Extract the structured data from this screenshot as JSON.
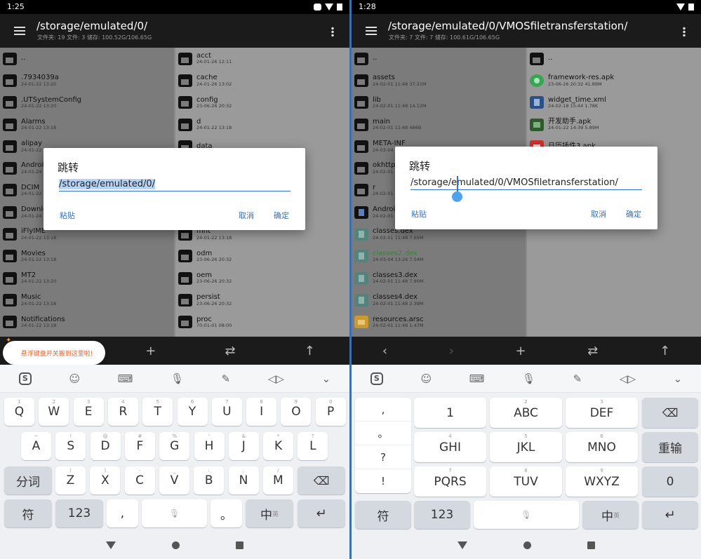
{
  "left": {
    "status": {
      "time": "1:25"
    },
    "appbar": {
      "title": "/storage/emulated/0/",
      "subtitle": "文件夹: 19  文件: 3  储存: 100.52G/106.65G"
    },
    "col1": [
      {
        "name": "..",
        "meta": ""
      },
      {
        "name": ".7934039a",
        "meta": "24-01-22 13:20"
      },
      {
        "name": ".UTSystemConfig",
        "meta": "24-01-22 13:20"
      },
      {
        "name": "Alarms",
        "meta": "24-01-22 13:18"
      },
      {
        "name": "alipay",
        "meta": "24-01-22"
      },
      {
        "name": "Android",
        "meta": "24-01-24"
      },
      {
        "name": "DCIM",
        "meta": "24-01-22"
      },
      {
        "name": "Download",
        "meta": "24-01-24"
      },
      {
        "name": "iFlyIME",
        "meta": "24-01-22 13:18"
      },
      {
        "name": "Movies",
        "meta": "24-01-22 13:18"
      },
      {
        "name": "MT2",
        "meta": "24-01-22 13:20"
      },
      {
        "name": "Music",
        "meta": "24-01-22 13:18"
      },
      {
        "name": "Notifications",
        "meta": "24-01-22 13:18"
      }
    ],
    "col2": [
      {
        "name": "acct",
        "meta": "24-01-26 12:11"
      },
      {
        "name": "cache",
        "meta": "24-01-26 13:02"
      },
      {
        "name": "config",
        "meta": "23-06-26 20:32"
      },
      {
        "name": "d",
        "meta": "24-01-22 13:18"
      },
      {
        "name": "data",
        "meta": ""
      },
      {
        "name": "",
        "meta": ""
      },
      {
        "name": "",
        "meta": ""
      },
      {
        "name": "",
        "meta": ""
      },
      {
        "name": "mnt",
        "meta": "24-01-22 13:18"
      },
      {
        "name": "odm",
        "meta": "23-06-26 20:32"
      },
      {
        "name": "oem",
        "meta": "23-06-26 20:32"
      },
      {
        "name": "persist",
        "meta": "23-06-26 20:32"
      },
      {
        "name": "proc",
        "meta": "70-01-01 08:00"
      }
    ],
    "dialog": {
      "title": "跳转",
      "value": "/storage/emulated/0/",
      "paste": "粘贴",
      "cancel": "取消",
      "ok": "确定"
    },
    "toast": "悬浮键盘开关搬到这里啦!",
    "toolbar": [
      "+",
      "⇄",
      "↑"
    ]
  },
  "right": {
    "status": {
      "time": "1:28"
    },
    "appbar": {
      "title": "/storage/emulated/0/VMOSfiletransferstation/",
      "subtitle": "文件夹: 7  文件: 7  储存: 100.61G/106.65G"
    },
    "col1": [
      {
        "name": "..",
        "meta": "",
        "icon": "folder"
      },
      {
        "name": "assets",
        "meta": "24-02-01 11:48  37.21M",
        "icon": "folder"
      },
      {
        "name": "lib",
        "meta": "24-02-01 11:48  14.12M",
        "icon": "folder"
      },
      {
        "name": "main",
        "meta": "24-02-01 11:48  486B",
        "icon": "folder"
      },
      {
        "name": "META-INF",
        "meta": "24-03-04",
        "icon": "folder"
      },
      {
        "name": "okhttp3",
        "meta": "24-02-01",
        "icon": "folder"
      },
      {
        "name": "r",
        "meta": "24-02-01",
        "icon": "folder"
      },
      {
        "name": "Android",
        "meta": "24-02-01",
        "icon": "doc"
      },
      {
        "name": "classes.dex",
        "meta": "24-02-01 11:48  7.65M",
        "icon": "dex"
      },
      {
        "name": "classes2.dex",
        "meta": "24-03-04 13:26  7.54M",
        "icon": "dex",
        "green": true
      },
      {
        "name": "classes3.dex",
        "meta": "24-02-01 11:48  7.90M",
        "icon": "dex"
      },
      {
        "name": "classes4.dex",
        "meta": "24-02-01 11:48  2.39M",
        "icon": "dex"
      },
      {
        "name": "resources.arsc",
        "meta": "24-02-01 11:48  1.47M",
        "icon": "arsc"
      }
    ],
    "col2": [
      {
        "name": "..",
        "meta": "",
        "icon": "folder"
      },
      {
        "name": "framework-res.apk",
        "meta": "23-06-26 20:32  41.89M",
        "icon": "apk"
      },
      {
        "name": "widget_time.xml",
        "meta": "24-02-18 15:44  1.78K",
        "icon": "xml"
      },
      {
        "name": "开发助手.apk",
        "meta": "24-01-22 14:39  5.89M",
        "icon": "pic"
      },
      {
        "name": "日历插件3.apk",
        "meta": "",
        "icon": "cal"
      }
    ],
    "dialog": {
      "title": "跳转",
      "value": "/storage/emulated/0/VMOSfiletransferstation/",
      "paste": "粘贴",
      "cancel": "取消",
      "ok": "确定"
    },
    "toolbar": [
      "‹",
      "›",
      "+",
      "⇄",
      "↑"
    ]
  },
  "keyboard_left": {
    "row1": [
      [
        "Q",
        "1"
      ],
      [
        "W",
        "2"
      ],
      [
        "E",
        "3"
      ],
      [
        "R",
        "4"
      ],
      [
        "T",
        "5"
      ],
      [
        "Y",
        "6"
      ],
      [
        "U",
        "7"
      ],
      [
        "I",
        "8"
      ],
      [
        "O",
        "9"
      ],
      [
        "P",
        "0"
      ]
    ],
    "row2": [
      [
        "A",
        "~"
      ],
      [
        "S",
        "!"
      ],
      [
        "D",
        "@"
      ],
      [
        "F",
        "#"
      ],
      [
        "G",
        "%"
      ],
      [
        "H",
        "'"
      ],
      [
        "J",
        "&"
      ],
      [
        "K",
        "*"
      ],
      [
        "L",
        "?"
      ]
    ],
    "row3": [
      [
        "Z",
        "("
      ],
      [
        "X",
        ")"
      ],
      [
        "C",
        "-"
      ],
      [
        "V",
        "_"
      ],
      [
        "B",
        ":"
      ],
      [
        "N",
        ";"
      ],
      [
        "M",
        "/"
      ]
    ],
    "fenci": "分词",
    "fu": "符",
    "num": "123",
    "comma": ",",
    "period": "。",
    "zh": "中",
    "ying": "英"
  },
  "keyboard_right": {
    "side": [
      ",",
      "。",
      "?",
      "!"
    ],
    "grid": [
      [
        "1",
        ""
      ],
      [
        "ABC",
        "2"
      ],
      [
        "DEF",
        "3"
      ],
      [
        "GHI",
        "4"
      ],
      [
        "JKL",
        "5"
      ],
      [
        "MNO",
        "6"
      ],
      [
        "PQRS",
        "7"
      ],
      [
        "TUV",
        "8"
      ],
      [
        "WXYZ",
        "9"
      ]
    ],
    "chongshu": "重输",
    "zero": "0",
    "fu": "符",
    "num": "123",
    "zh": "中",
    "ying": "英"
  }
}
